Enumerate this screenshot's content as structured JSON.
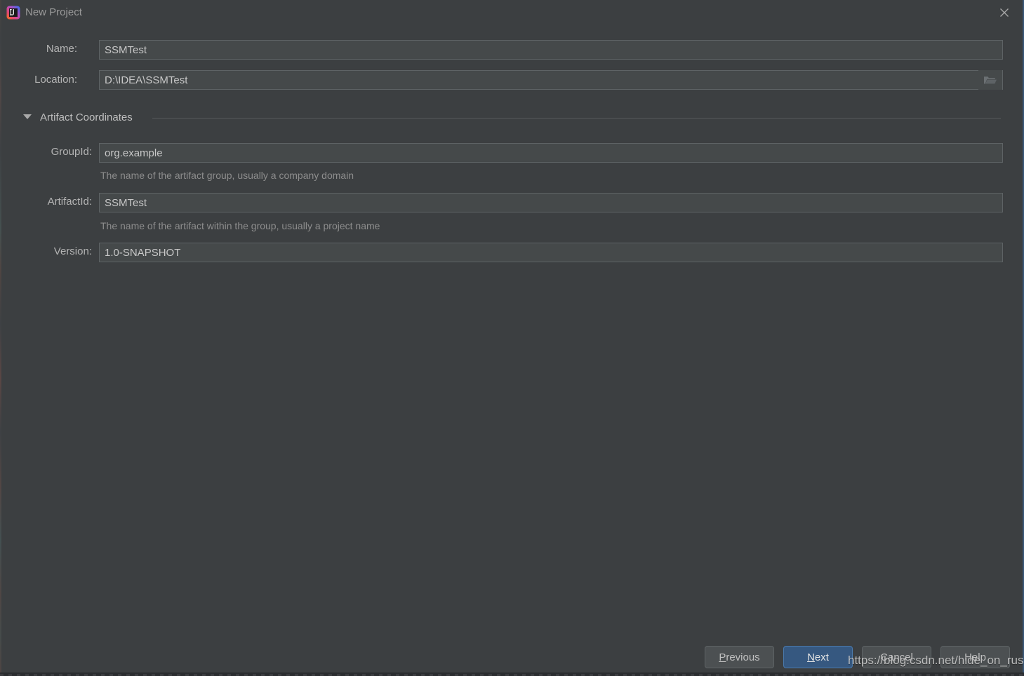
{
  "window": {
    "title": "New Project",
    "app_icon": "intellij-idea-logo",
    "close_icon": "close-icon",
    "background_color": "#3c3f41"
  },
  "form": {
    "name": {
      "label": "Name:",
      "value": "SSMTest",
      "placeholder": ""
    },
    "location": {
      "label": "Location:",
      "value": "D:\\IDEA\\SSMTest",
      "placeholder": "",
      "browse_icon": "folder-icon"
    }
  },
  "artifact_section": {
    "title": "Artifact Coordinates",
    "expanded": true,
    "collapse_icon": "chevron-down-icon",
    "fields": {
      "group_id": {
        "label": "GroupId:",
        "value": "org.example",
        "hint": "The name of the artifact group, usually a company domain"
      },
      "artifact_id": {
        "label": "ArtifactId:",
        "value": "SSMTest",
        "hint": "The name of the artifact within the group, usually a project name"
      },
      "version": {
        "label": "Version:",
        "value": "1.0-SNAPSHOT",
        "hint": ""
      }
    }
  },
  "footer": {
    "buttons": [
      {
        "id": "previous",
        "label": "Previous",
        "mnemonic": "P",
        "rest": "revious",
        "primary": false
      },
      {
        "id": "next",
        "label": "Next",
        "mnemonic": "N",
        "rest": "ext",
        "primary": true
      },
      {
        "id": "cancel",
        "label": "Cancel",
        "mnemonic": "",
        "rest": "Cancel",
        "primary": false
      },
      {
        "id": "help",
        "label": "Help",
        "mnemonic": "",
        "rest": "Help",
        "primary": false
      }
    ]
  },
  "watermark": {
    "text": "https://blog.csdn.net/hide_on_rush"
  },
  "colors": {
    "dialog_bg": "#3c3f41",
    "input_bg": "#45494a",
    "input_border": "#5e6365",
    "primary_button": "#365880",
    "primary_button_border": "#4a7aad",
    "label_text": "#b4b4b4",
    "hint_text": "#8d8d8d",
    "title_text": "#9a9a9a"
  }
}
